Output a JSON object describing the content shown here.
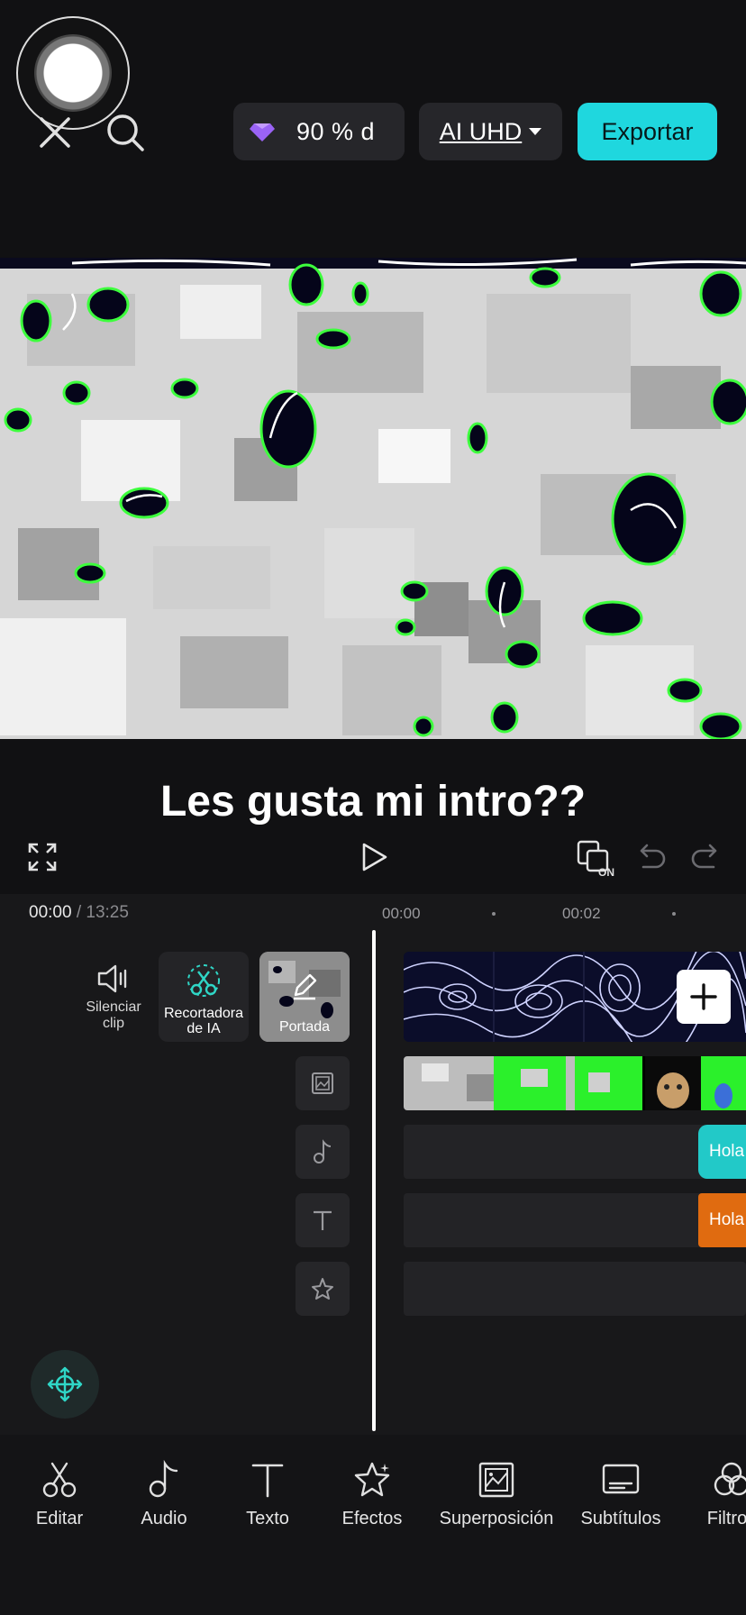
{
  "header": {
    "close_icon": "close-icon",
    "search_icon": "search-icon",
    "credits_text": "90 % d",
    "quality_label": "AI UHD",
    "export_label": "Exportar"
  },
  "preview": {
    "caption": "Les gusta mi intro??"
  },
  "timeline": {
    "current_time": "00:00",
    "separator": "/",
    "total_time": "13:25",
    "ruler_marks": [
      "00:00",
      "00:02"
    ],
    "mute_label_line1": "Silenciar",
    "mute_label_line2": "clip",
    "ai_cutout_line1": "Recortadora",
    "ai_cutout_line2": "de IA",
    "cover_label": "Portada",
    "text_clip_1": "Hola",
    "text_clip_2": "Hola"
  },
  "toolbar": {
    "items": [
      {
        "label": "Editar",
        "icon": "scissors-icon"
      },
      {
        "label": "Audio",
        "icon": "music-note-icon"
      },
      {
        "label": "Texto",
        "icon": "text-icon"
      },
      {
        "label": "Efectos",
        "icon": "star-icon"
      },
      {
        "label": "Superposición",
        "icon": "overlay-icon"
      },
      {
        "label": "Subtítulos",
        "icon": "subtitles-icon"
      },
      {
        "label": "Filtros",
        "icon": "filters-icon"
      }
    ]
  },
  "colors": {
    "accent": "#1fd7de",
    "background": "#111113",
    "text_clip_teal": "#22c9c8",
    "text_clip_orange": "#e06b10"
  }
}
